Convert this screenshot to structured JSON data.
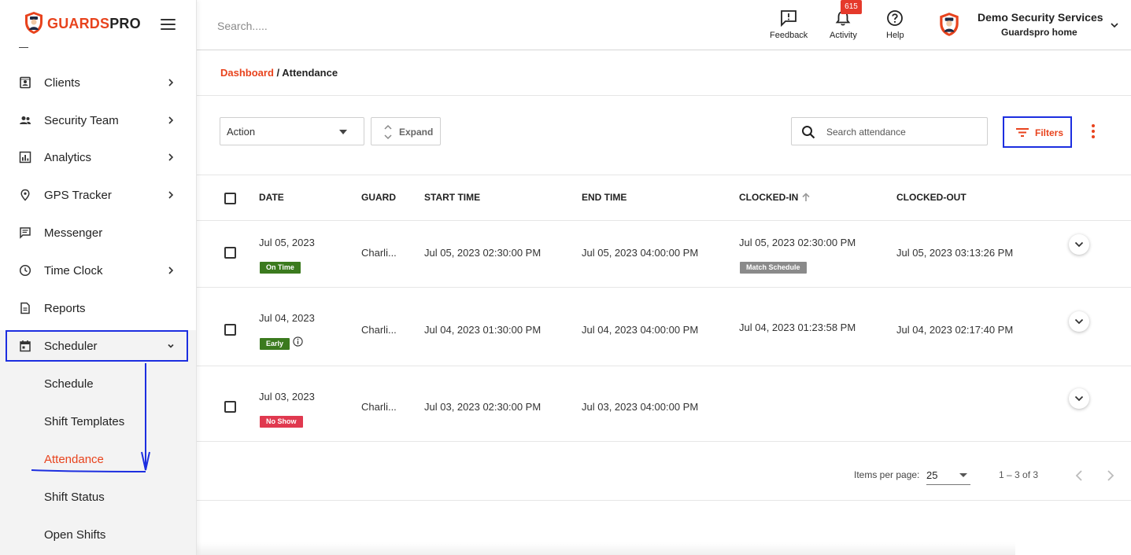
{
  "brand": {
    "name_part1": "GUARDS",
    "name_part2": "PRO",
    "accent_color": "#e8431d"
  },
  "sidebar": {
    "items": [
      {
        "label": "Clients",
        "icon": "contacts-icon",
        "has_chevron": true
      },
      {
        "label": "Security Team",
        "icon": "people-icon",
        "has_chevron": true
      },
      {
        "label": "Analytics",
        "icon": "bar-chart-icon",
        "has_chevron": true
      },
      {
        "label": "GPS Tracker",
        "icon": "location-pin-icon",
        "has_chevron": true
      },
      {
        "label": "Messenger",
        "icon": "chat-icon",
        "has_chevron": false
      },
      {
        "label": "Time Clock",
        "icon": "clock-icon",
        "has_chevron": true
      },
      {
        "label": "Reports",
        "icon": "document-icon",
        "has_chevron": false
      },
      {
        "label": "Scheduler",
        "icon": "calendar-icon",
        "has_chevron": true,
        "expanded": true
      }
    ],
    "subitems": [
      {
        "label": "Schedule"
      },
      {
        "label": "Shift Templates"
      },
      {
        "label": "Attendance",
        "current": true
      },
      {
        "label": "Shift Status"
      },
      {
        "label": "Open Shifts"
      }
    ]
  },
  "topbar": {
    "search_placeholder": "Search.....",
    "feedback_label": "Feedback",
    "activity_label": "Activity",
    "activity_badge": "615",
    "help_label": "Help",
    "org_name": "Demo Security Services",
    "org_sub": "Guardspro home"
  },
  "breadcrumb": {
    "root": "Dashboard",
    "separator": " / ",
    "current": "Attendance"
  },
  "toolbar": {
    "action_label": "Action",
    "expand_label": "Expand",
    "search_placeholder": "Search attendance",
    "filters_label": "Filters"
  },
  "table": {
    "headers": {
      "date": "DATE",
      "guard": "GUARD",
      "start": "START TIME",
      "end": "END TIME",
      "clocked_in": "CLOCKED-IN",
      "clocked_out": "CLOCKED-OUT"
    },
    "rows": [
      {
        "date": "Jul 05, 2023",
        "status": "On Time",
        "status_color": "#3b7a1e",
        "guard": "Charli...",
        "start": "Jul 05, 2023 02:30:00 PM",
        "end": "Jul 05, 2023 04:00:00 PM",
        "clocked_in": "Jul 05, 2023 02:30:00 PM",
        "clocked_in_tag": "Match Schedule",
        "clocked_out": "Jul 05, 2023 03:13:26 PM"
      },
      {
        "date": "Jul 04, 2023",
        "status": "Early",
        "status_color": "#3b7a1e",
        "guard": "Charli...",
        "start": "Jul 04, 2023 01:30:00 PM",
        "end": "Jul 04, 2023 04:00:00 PM",
        "clocked_in": "Jul 04, 2023 01:23:58 PM",
        "clocked_in_tag": "",
        "clocked_out": "Jul 04, 2023 02:17:40 PM"
      },
      {
        "date": "Jul 03, 2023",
        "status": "No Show",
        "status_color": "#e0394f",
        "guard": "Charli...",
        "start": "Jul 03, 2023 02:30:00 PM",
        "end": "Jul 03, 2023 04:00:00 PM",
        "clocked_in": "",
        "clocked_in_tag": "",
        "clocked_out": ""
      }
    ]
  },
  "pagination": {
    "items_per_page_label": "Items per page:",
    "items_per_page": "25",
    "range": "1 – 3 of 3"
  },
  "colors": {
    "match_schedule_tag": "#8a8a8a",
    "annotation": "#1c2ee0",
    "badge": "#e5392b"
  }
}
